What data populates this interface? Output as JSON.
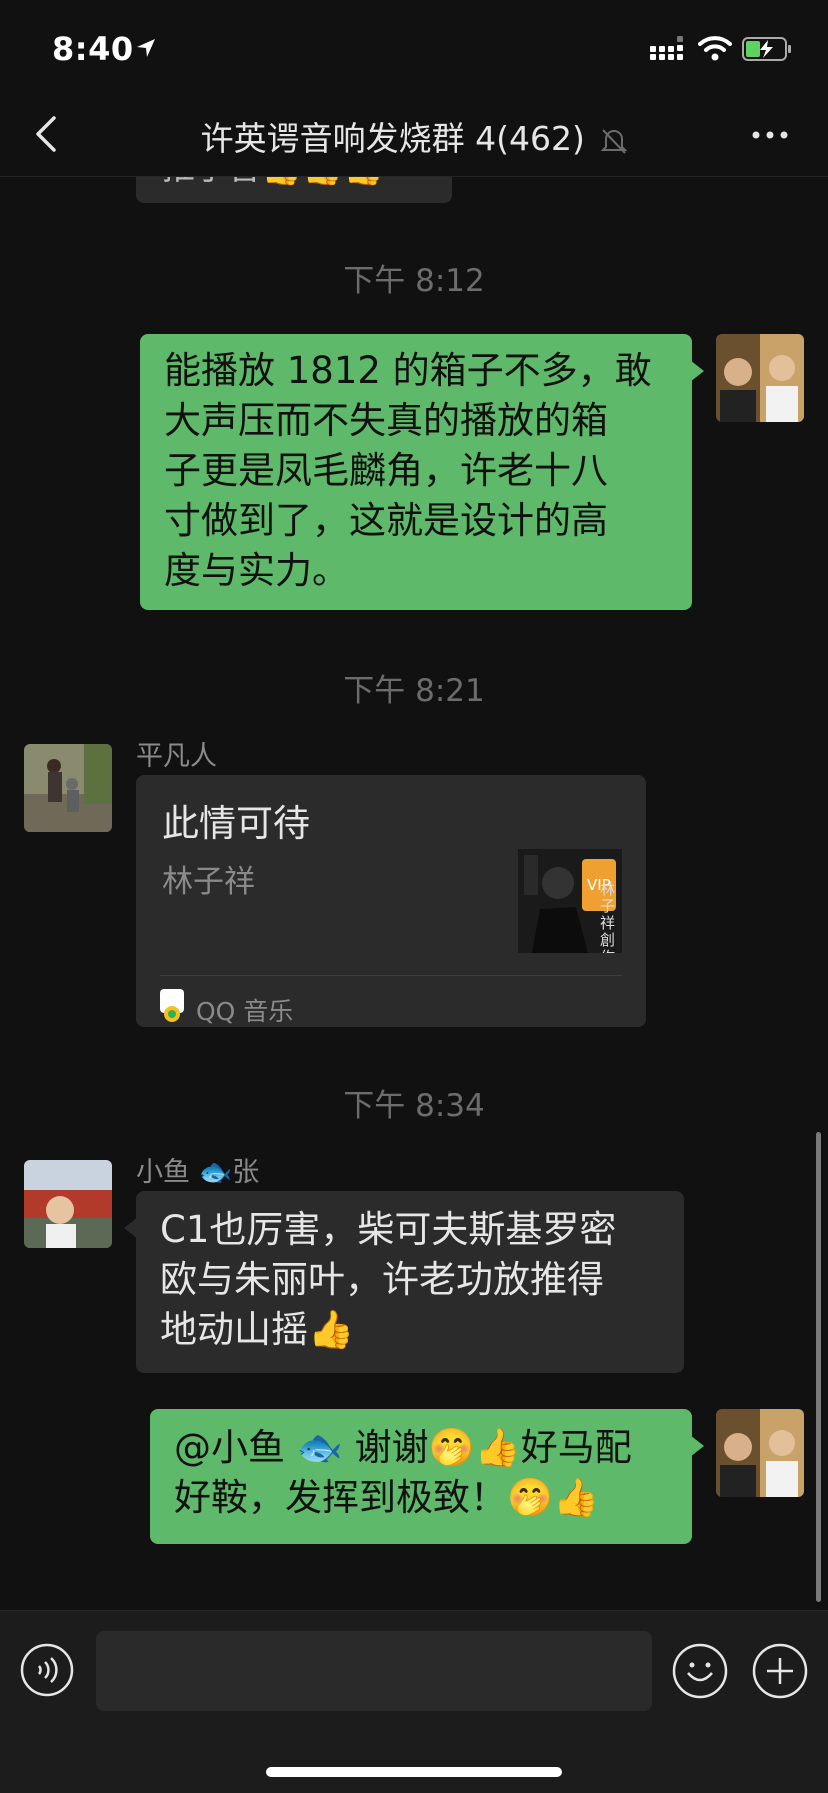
{
  "status_bar": {
    "time": "8:40"
  },
  "nav": {
    "title": "许英谔音响发烧群 4(462)",
    "back_icon": "chevron-left-icon",
    "more_icon": "more-dots-icon",
    "muted_icon": "bell-slash-icon"
  },
  "messages": [
    {
      "type": "partial",
      "sender": "other",
      "text": "推手音👍👍👍"
    },
    {
      "type": "timestamp",
      "text": "下午 8:12"
    },
    {
      "type": "text",
      "sender": "me",
      "lines": [
        "能播放 1812 的箱子不多，敢",
        "大声压而不失真的播放的箱",
        "子更是凤毛麟角，许老十八",
        "寸做到了，这就是设计的高",
        "度与实力。"
      ]
    },
    {
      "type": "timestamp",
      "text": "下午 8:21"
    },
    {
      "type": "music_card",
      "sender": "other",
      "name": "平凡人",
      "song": "此情可待",
      "artist": "林子祥",
      "source": "QQ 音乐",
      "cover_badge": "VIP",
      "cover_text": "林子祥創作歌集"
    },
    {
      "type": "timestamp",
      "text": "下午 8:34"
    },
    {
      "type": "text",
      "sender": "other",
      "name": "小鱼 🐟张",
      "lines": [
        "C1也厉害，柴可夫斯基罗密",
        "欧与朱丽叶，许老功放推得",
        "地动山摇👍"
      ]
    },
    {
      "type": "text",
      "sender": "me",
      "lines": [
        "@小鱼 🐟 谢谢🤭👍好马配",
        "好鞍，发挥到极致！🤭👍"
      ]
    }
  ],
  "input_bar": {
    "voice_icon": "voice-icon",
    "emoji_icon": "emoji-icon",
    "plus_icon": "plus-icon",
    "placeholder": ""
  },
  "colors": {
    "background": "#111111",
    "my_bubble": "#5eb96a",
    "other_bubble": "#2b2b2b"
  }
}
